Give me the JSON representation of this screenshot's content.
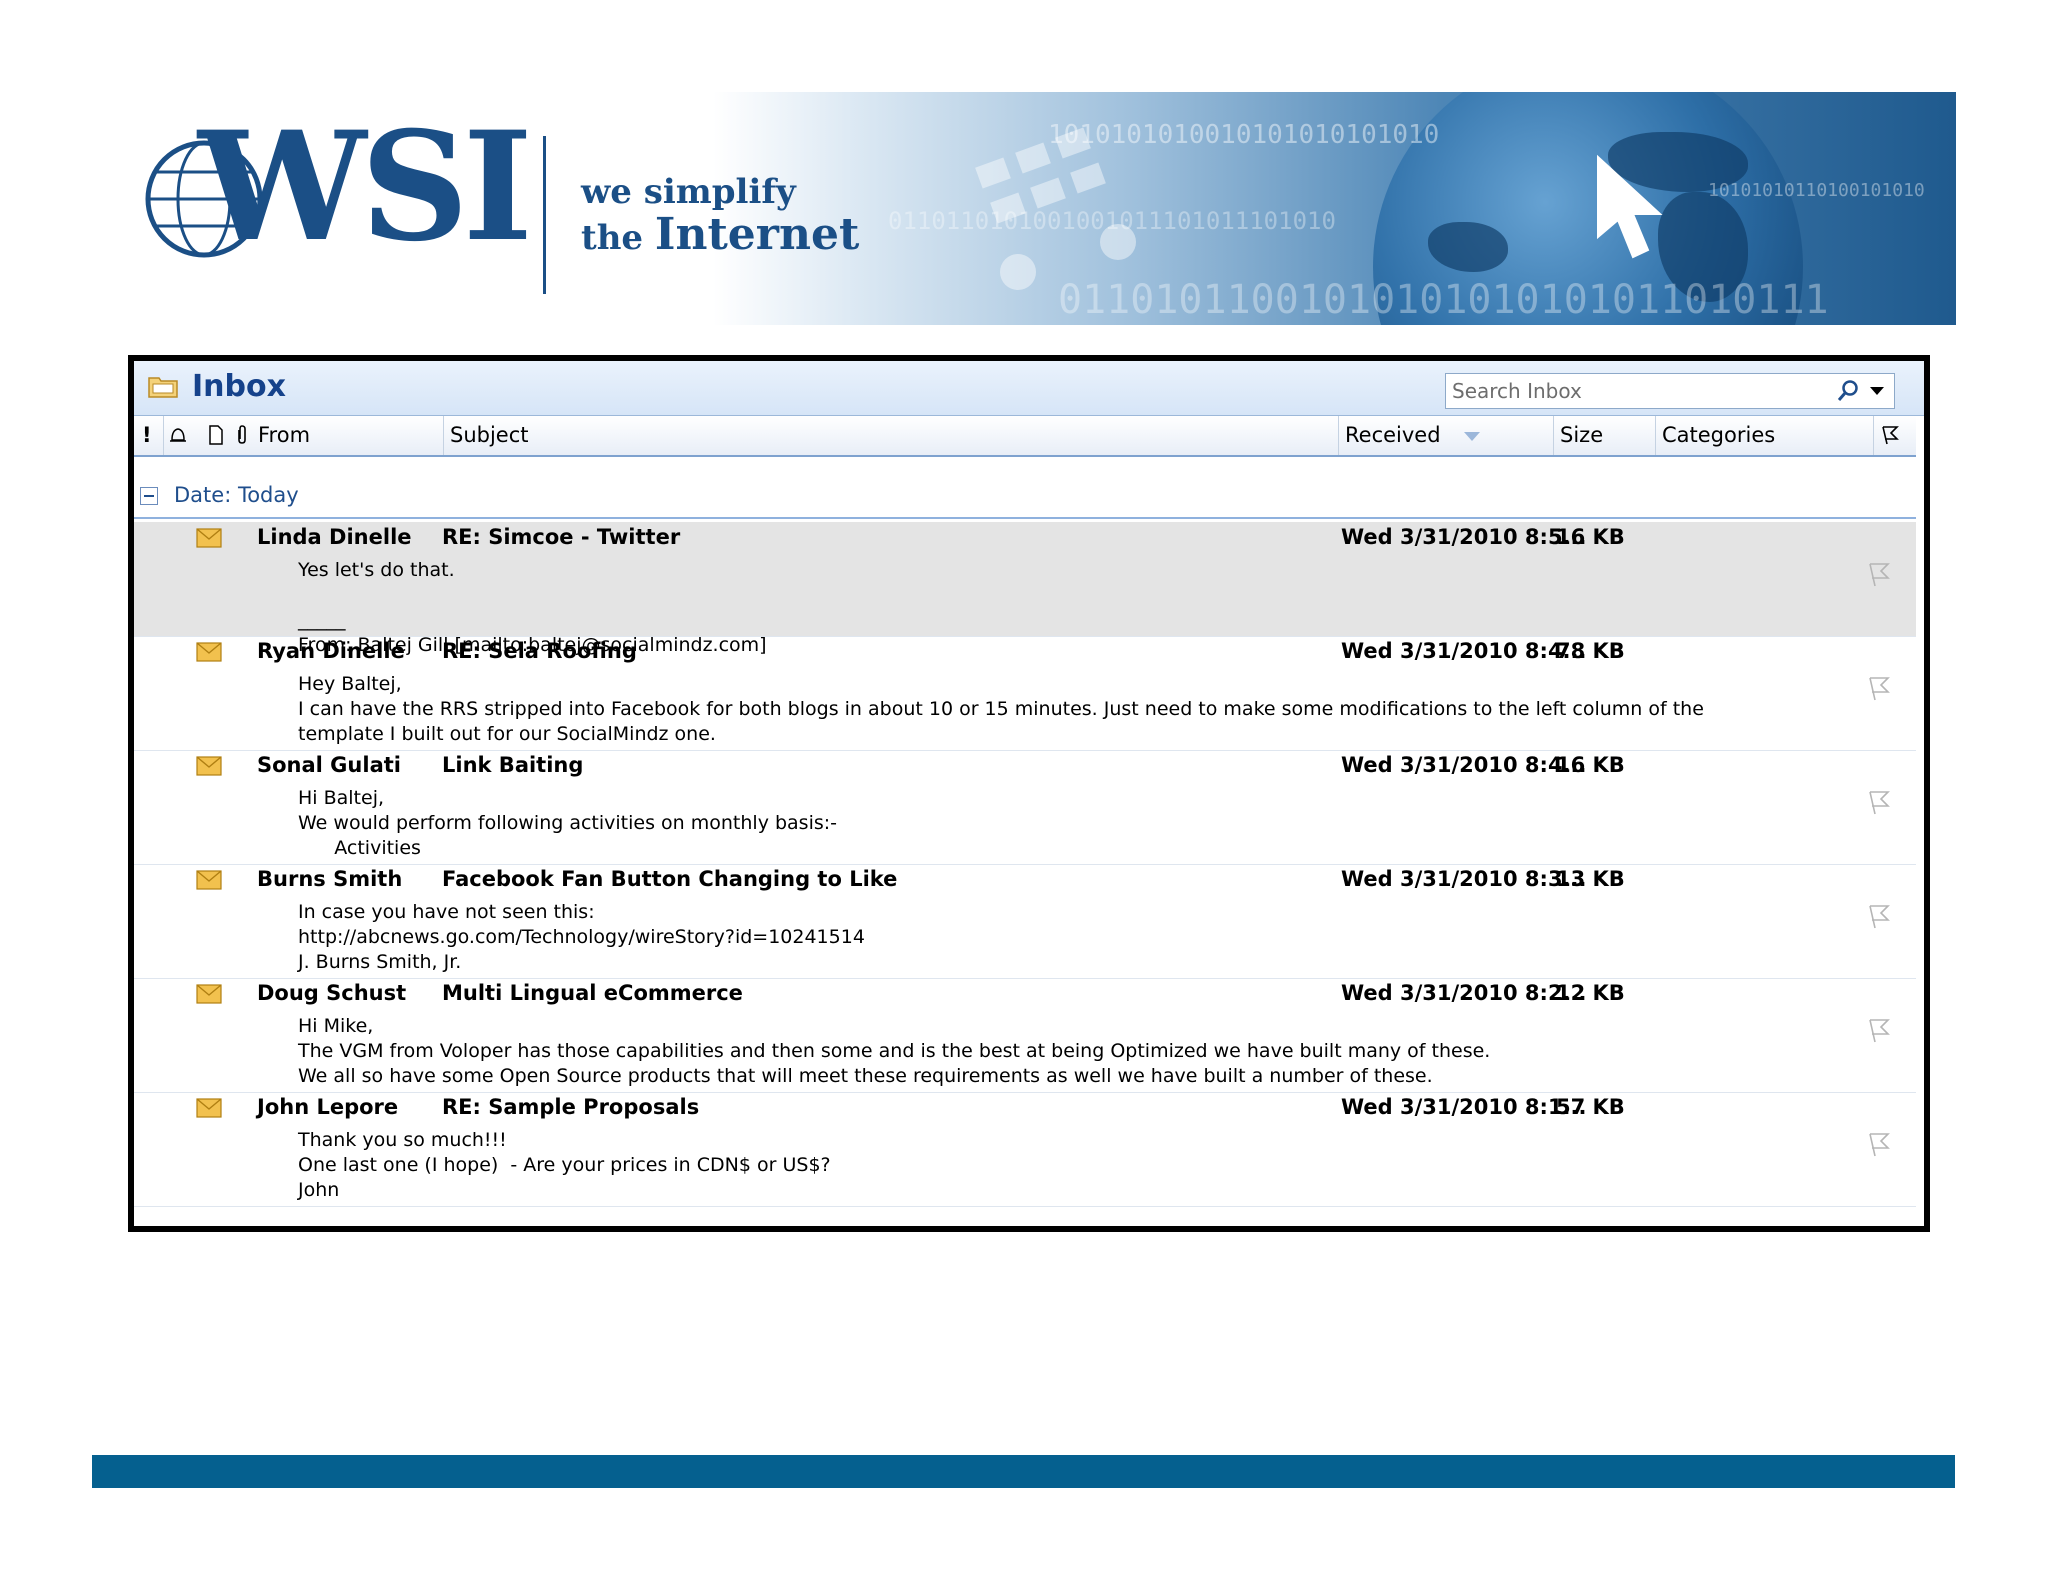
{
  "banner": {
    "logo_text": "WSI",
    "tagline_line1": "we simplify",
    "tagline_the": "the",
    "tagline_internet": "Internet"
  },
  "window": {
    "title": "Inbox",
    "search_placeholder": "Search Inbox"
  },
  "columns": {
    "importance": "!",
    "from": "From",
    "subject": "Subject",
    "received": "Received",
    "size": "Size",
    "categories": "Categories"
  },
  "group": {
    "label": "Date: Today"
  },
  "emails": [
    {
      "from": "Linda Dinelle",
      "subject": "RE: Simcoe - Twitter",
      "received": "Wed 3/31/2010 8:5...",
      "size": "16 KB",
      "preview": "Yes let's do that.\n\n_____\nFrom: Baltej Gill [mailto:baltej@socialmindz.com]",
      "selected": true
    },
    {
      "from": "Ryan Dinelle",
      "subject": "RE: Sela Roofing",
      "received": "Wed 3/31/2010 8:4...",
      "size": "78 KB",
      "preview": "Hey Baltej,\nI can have the RRS stripped into Facebook for both blogs in about 10 or 15 minutes. Just need to make some modifications to the left column of the\ntemplate I built out for our SocialMindz one.",
      "selected": false
    },
    {
      "from": "Sonal Gulati",
      "subject": "Link Baiting",
      "received": "Wed 3/31/2010 8:4...",
      "size": "16 KB",
      "preview": "Hi Baltej,\nWe would perform following activities on monthly basis:-\n      Activities",
      "selected": false
    },
    {
      "from": "Burns Smith",
      "subject": "Facebook Fan Button Changing to Like",
      "received": "Wed 3/31/2010 8:3...",
      "size": "13 KB",
      "preview": "In case you have not seen this:\nhttp://abcnews.go.com/Technology/wireStory?id=10241514\nJ. Burns Smith, Jr.",
      "selected": false
    },
    {
      "from": "Doug Schust",
      "subject": "Multi Lingual eCommerce",
      "received": "Wed 3/31/2010 8:2...",
      "size": "12 KB",
      "preview": "Hi Mike,\nThe VGM from Voloper has those capabilities and then some and is the best at being Optimized we have built many of these.\nWe all so have some Open Source products that will meet these requirements as well we have built a number of these.",
      "selected": false
    },
    {
      "from": "John Lepore",
      "subject": "RE: Sample Proposals",
      "received": "Wed 3/31/2010 8:1...",
      "size": "57 KB",
      "preview": "Thank you so much!!!\nOne last one (I hope)  - Are your prices in CDN$ or US$?\nJohn",
      "selected": false
    }
  ],
  "colors": {
    "brand_blue": "#1b4f86",
    "header_blue": "#15428b",
    "footer_bar": "#05608f",
    "mail_icon": "#f2c14e"
  }
}
